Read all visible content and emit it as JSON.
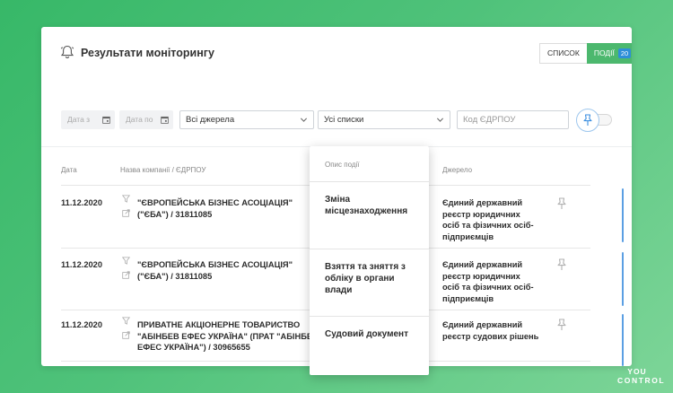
{
  "header": {
    "title": "Результати моніторингу",
    "list_label": "СПИСОК",
    "events_label": "ПОДІЇ",
    "events_count": "20"
  },
  "filters": {
    "date_from_placeholder": "Дата з",
    "date_to_placeholder": "Дата по",
    "sources_value": "Всі джерела",
    "lists_value": "Усі списки",
    "code_placeholder": "Код ЄДРПОУ"
  },
  "table": {
    "columns": {
      "date": "Дата",
      "company": "Назва компанії / ЄДРПОУ",
      "source": "Джерело"
    },
    "rows": [
      {
        "date": "11.12.2020",
        "company": "\"ЄВРОПЕЙСЬКА БІЗНЕС АСОЦІАЦІЯ\" (\"ЄБА\") / 31811085",
        "source": "Єдиний державний реєстр юридичних осіб та фізичних осіб-підприємців"
      },
      {
        "date": "11.12.2020",
        "company": "\"ЄВРОПЕЙСЬКА БІЗНЕС АСОЦІАЦІЯ\" (\"ЄБА\") / 31811085",
        "source": "Єдиний державний реєстр юридичних осіб та фізичних осіб-підприємців"
      },
      {
        "date": "11.12.2020",
        "company": "ПРИВАТНЕ АКЦІОНЕРНЕ ТОВАРИСТВО \"АБІНБЕВ ЕФЕС УКРАЇНА\" (ПРАТ \"АБІНБЕВ ЕФЕС УКРАЇНА\") / 30965655",
        "source": "Єдиний державний реєстр судових рішень"
      }
    ]
  },
  "event_dropdown": {
    "header": "Опис події",
    "items": [
      "Зміна місцезнаходження",
      "Взяття та зняття з обліку в органи влади",
      "Судовий документ"
    ]
  },
  "brand": {
    "line1": "YOU",
    "line2": "CONTROL"
  },
  "colors": {
    "accent_green": "#4cb86e",
    "badge_blue": "#2e8fd8",
    "background_green": "#37b868"
  },
  "icons": [
    "bell-icon",
    "calendar-icon",
    "chevron-down-icon",
    "pin-icon",
    "filter-icon",
    "external-link-icon"
  ]
}
